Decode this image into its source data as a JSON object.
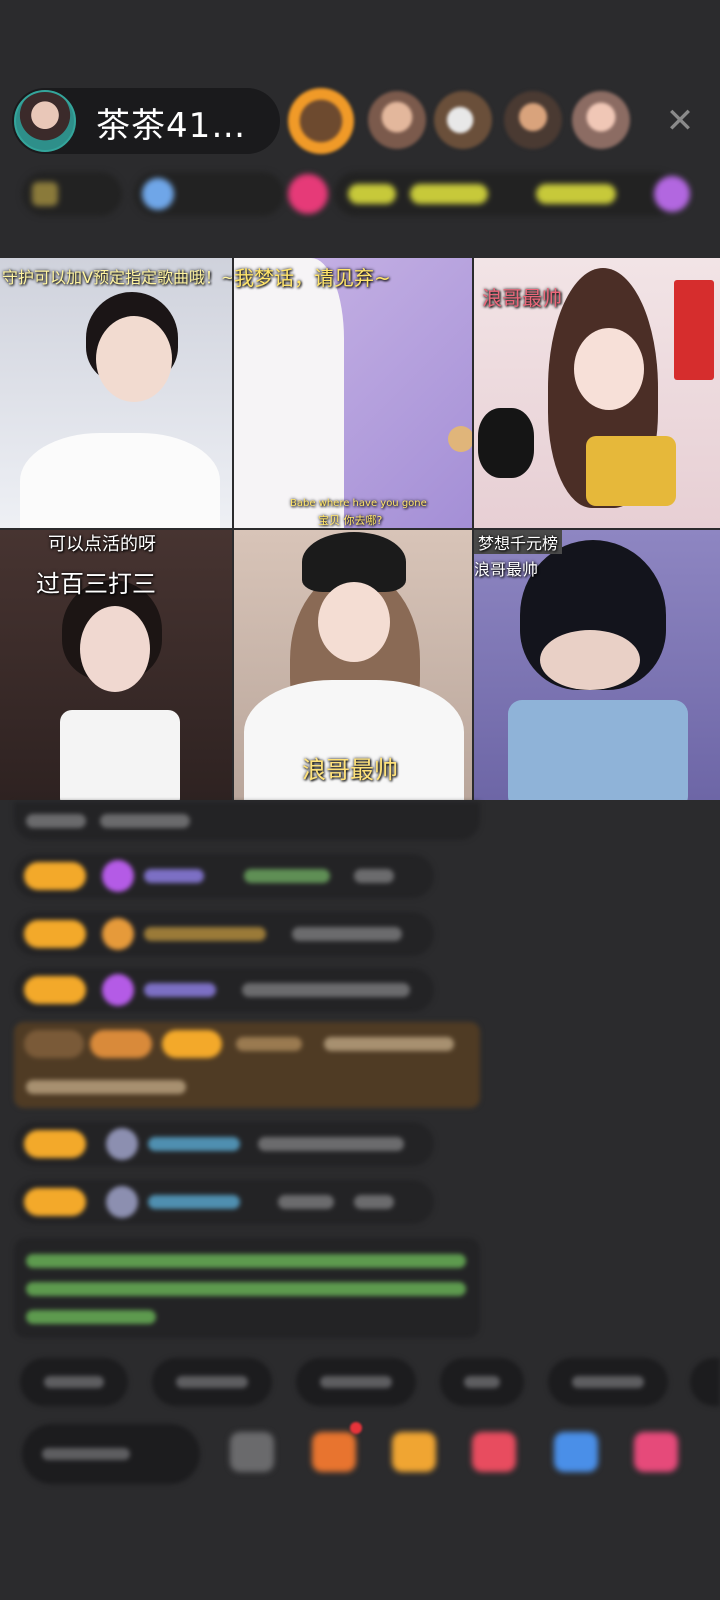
{
  "header": {
    "host_name": "茶茶41…",
    "close_icon": "close-icon"
  },
  "grid": {
    "tiles": [
      {
        "caption": "守护可以加V预定指定歌曲哦！~"
      },
      {
        "caption": "我梦话，请见弃~",
        "subtitle": "Babe where have you gone",
        "subtitle2": "宝贝 你去哪?"
      },
      {
        "caption": "浪哥最帅"
      },
      {
        "caption": "可以点活的呀",
        "caption2": "过百三打三"
      },
      {
        "caption": "浪哥最帅"
      },
      {
        "caption": "梦想千元榜",
        "caption2": "浪哥最帅"
      }
    ]
  },
  "colors": {
    "background": "#2b2b2d",
    "badge_orange": "#f3a92a",
    "chat_green": "#7fd06a",
    "chat_blue": "#5fb3e0",
    "caption_yellow": "#ffe46a"
  }
}
